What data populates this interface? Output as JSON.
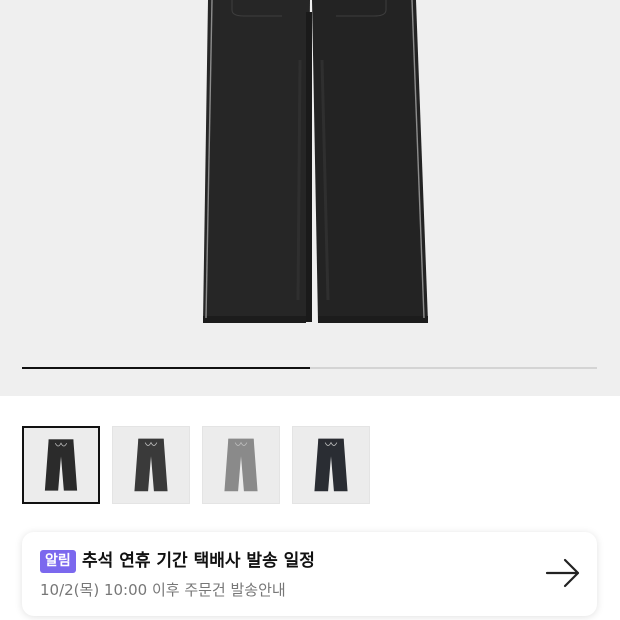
{
  "gallery": {
    "image_name": "black-wide-pants-product-image",
    "progress": 0.5,
    "thumbnails": [
      {
        "name": "black-pants-thumbnail",
        "color": "#2b2b2b",
        "active": true
      },
      {
        "name": "charcoal-pants-thumbnail",
        "color": "#3a3a3a",
        "active": false
      },
      {
        "name": "gray-pants-thumbnail",
        "color": "#8a8a8a",
        "active": false
      },
      {
        "name": "dark-navy-pants-thumbnail",
        "color": "#2a2d33",
        "active": false
      }
    ]
  },
  "notice": {
    "badge": "알림",
    "title": "추석 연휴 기간 택배사 발송 일정",
    "subtitle": "10/2(목) 10:00 이후 주문건 발송안내",
    "arrow_icon": "arrow-right-icon",
    "badge_color": "#7b68ee"
  }
}
